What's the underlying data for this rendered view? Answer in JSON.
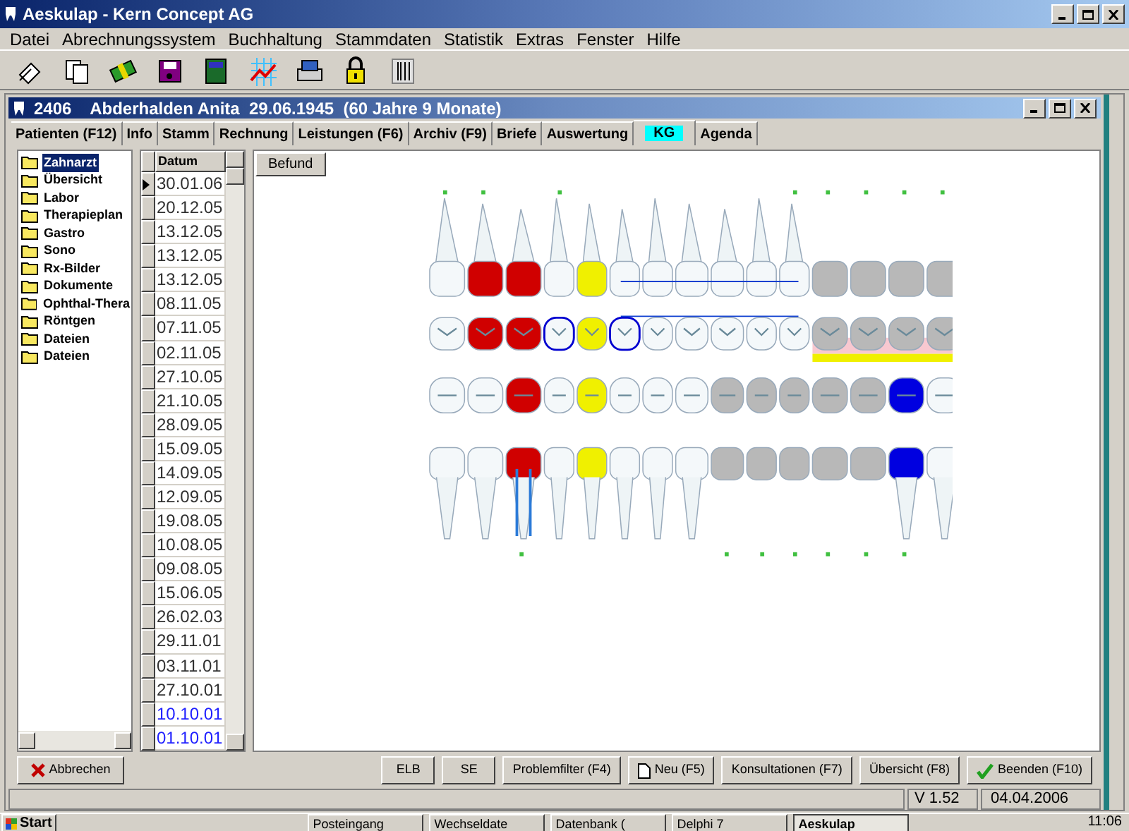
{
  "window": {
    "title": "Aeskulap - Kern Concept AG"
  },
  "menu": [
    "Datei",
    "Abrechnungssystem",
    "Buchhaltung",
    "Stammdaten",
    "Statistik",
    "Extras",
    "Fenster",
    "Hilfe"
  ],
  "patient_window": {
    "title": "2406    Abderhalden Anita  29.06.1945  (60 Jahre 9 Monate)"
  },
  "tabs": [
    {
      "label": "Patienten (F12)",
      "selected": false
    },
    {
      "label": "Info",
      "selected": false
    },
    {
      "label": "Stamm",
      "selected": false
    },
    {
      "label": "Rechnung",
      "selected": false
    },
    {
      "label": "Leistungen (F6)",
      "selected": false
    },
    {
      "label": "Archiv (F9)",
      "selected": false
    },
    {
      "label": "Briefe",
      "selected": false
    },
    {
      "label": "Auswertung",
      "selected": false
    },
    {
      "label": "KG",
      "selected": true
    },
    {
      "label": "Agenda",
      "selected": false
    }
  ],
  "folders": [
    {
      "label": "Zahnarzt",
      "selected": true
    },
    {
      "label": "Übersicht",
      "selected": false
    },
    {
      "label": "Labor",
      "selected": false
    },
    {
      "label": "Therapieplan",
      "selected": false
    },
    {
      "label": "Gastro",
      "selected": false
    },
    {
      "label": "Sono",
      "selected": false
    },
    {
      "label": "Rx-Bilder",
      "selected": false
    },
    {
      "label": "Dokumente",
      "selected": false
    },
    {
      "label": "Ophthal-Thera",
      "selected": false
    },
    {
      "label": "Röntgen",
      "selected": false
    },
    {
      "label": "Dateien",
      "selected": false
    },
    {
      "label": "Dateien",
      "selected": false
    }
  ],
  "dates": {
    "column": "Datum",
    "rows": [
      {
        "date": "30.01.06",
        "selected": true,
        "color": "#303030"
      },
      {
        "date": "20.12.05",
        "selected": false,
        "color": "#303030"
      },
      {
        "date": "13.12.05",
        "selected": false,
        "color": "#303030"
      },
      {
        "date": "13.12.05",
        "selected": false,
        "color": "#303030"
      },
      {
        "date": "13.12.05",
        "selected": false,
        "color": "#303030"
      },
      {
        "date": "08.11.05",
        "selected": false,
        "color": "#303030"
      },
      {
        "date": "07.11.05",
        "selected": false,
        "color": "#303030"
      },
      {
        "date": "02.11.05",
        "selected": false,
        "color": "#303030"
      },
      {
        "date": "27.10.05",
        "selected": false,
        "color": "#303030"
      },
      {
        "date": "21.10.05",
        "selected": false,
        "color": "#303030"
      },
      {
        "date": "28.09.05",
        "selected": false,
        "color": "#303030"
      },
      {
        "date": "15.09.05",
        "selected": false,
        "color": "#303030"
      },
      {
        "date": "14.09.05",
        "selected": false,
        "color": "#303030"
      },
      {
        "date": "12.09.05",
        "selected": false,
        "color": "#303030"
      },
      {
        "date": "19.08.05",
        "selected": false,
        "color": "#303030"
      },
      {
        "date": "10.08.05",
        "selected": false,
        "color": "#303030"
      },
      {
        "date": "09.08.05",
        "selected": false,
        "color": "#303030"
      },
      {
        "date": "15.06.05",
        "selected": false,
        "color": "#303030"
      },
      {
        "date": "26.02.03",
        "selected": false,
        "color": "#303030"
      },
      {
        "date": "29.11.01",
        "selected": false,
        "color": "#303030"
      },
      {
        "date": "03.11.01",
        "selected": false,
        "color": "#303030"
      },
      {
        "date": "27.10.01",
        "selected": false,
        "color": "#303030"
      },
      {
        "date": "10.10.01",
        "selected": false,
        "color": "#2020ff"
      },
      {
        "date": "01.10.01",
        "selected": false,
        "color": "#2020ff"
      }
    ]
  },
  "befund_button": "Befund",
  "cancel_button": "Abbrechen",
  "buttons": [
    {
      "label": "ELB",
      "kind": "plain"
    },
    {
      "label": "SE",
      "kind": "plain"
    },
    {
      "label": "Problemfilter (F4)",
      "kind": "plain"
    },
    {
      "label": "Neu (F5)",
      "kind": "new"
    },
    {
      "label": "Konsultationen (F7)",
      "kind": "plain"
    },
    {
      "label": "Übersicht (F8)",
      "kind": "plain"
    },
    {
      "label": "Beenden (F10)",
      "kind": "ok"
    }
  ],
  "status_bar": {
    "version": "V 1.52",
    "date": "04.04.2006"
  },
  "taskbar": {
    "start": "Start",
    "tasks": [
      {
        "label": "Posteingang",
        "selected": false
      },
      {
        "label": "Wechseldate",
        "selected": false
      },
      {
        "label": "Datenbank (",
        "selected": false
      },
      {
        "label": "Delphi 7",
        "selected": false
      },
      {
        "label": "Aeskulap",
        "selected": true
      }
    ],
    "clock": "11:06"
  }
}
